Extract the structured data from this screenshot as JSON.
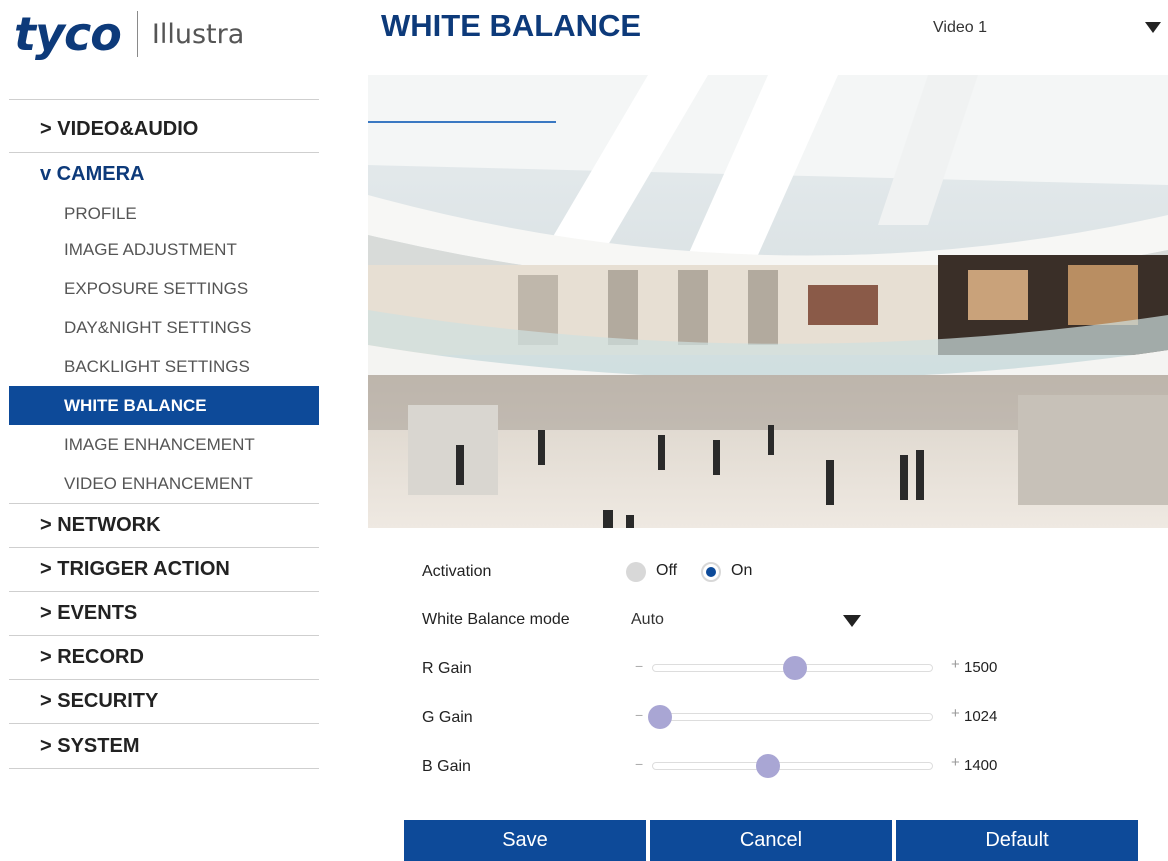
{
  "logo": {
    "brand": "tyco",
    "product": "Illustra"
  },
  "sidebar": {
    "video_audio": "> VIDEO&AUDIO",
    "camera": "v CAMERA",
    "camera_items": [
      "PROFILE",
      "IMAGE ADJUSTMENT",
      "EXPOSURE SETTINGS",
      "DAY&NIGHT SETTINGS",
      "BACKLIGHT SETTINGS",
      "WHITE BALANCE",
      "IMAGE ENHANCEMENT",
      "VIDEO ENHANCEMENT"
    ],
    "network": "> NETWORK",
    "trigger_action": "> TRIGGER ACTION",
    "events": "> EVENTS",
    "record": "> RECORD",
    "security": "> SECURITY",
    "system": "> SYSTEM"
  },
  "header": {
    "title": "WHITE BALANCE",
    "video_source": "Video 1"
  },
  "form": {
    "activation_label": "Activation",
    "off_label": "Off",
    "on_label": "On",
    "activation_value": "On",
    "mode_label": "White Balance mode",
    "mode_value": "Auto",
    "r_gain": {
      "label": "R Gain",
      "value": "1500",
      "fraction": 0.5
    },
    "g_gain": {
      "label": "G Gain",
      "value": "1024",
      "fraction": 0.0
    },
    "b_gain": {
      "label": "B Gain",
      "value": "1400",
      "fraction": 0.4
    }
  },
  "buttons": {
    "save": "Save",
    "cancel": "Cancel",
    "default": "Default"
  },
  "colors": {
    "brand_blue": "#0d4a99",
    "title_blue": "#0d3a7a",
    "slider_thumb": "#a9a6d4"
  }
}
